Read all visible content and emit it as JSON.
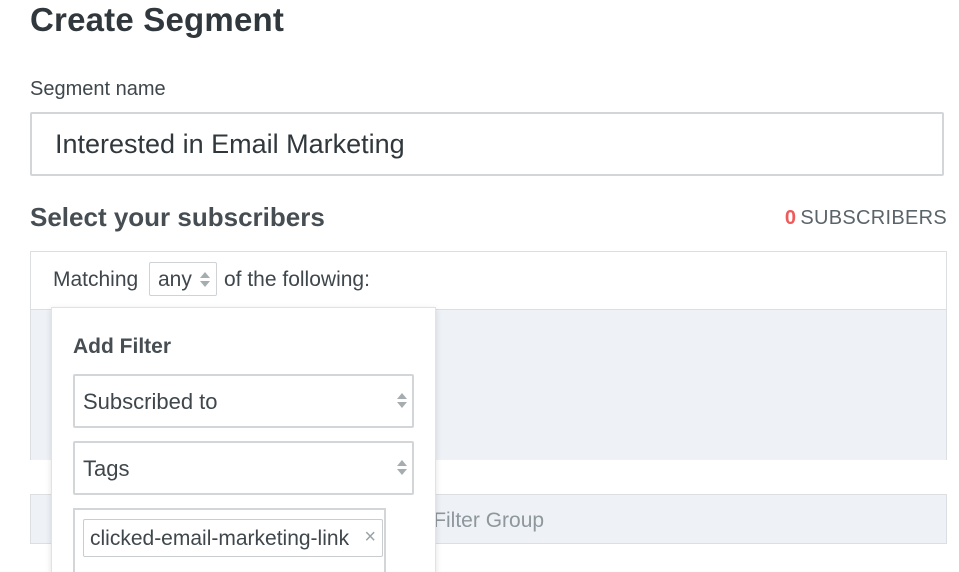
{
  "page": {
    "title": "Create Segment"
  },
  "segment_name": {
    "label": "Segment name",
    "value": "Interested in Email Marketing"
  },
  "subscribers": {
    "heading": "Select your subscribers",
    "count": "0",
    "count_label": "SUBSCRIBERS",
    "count_color": "#ef5b5b"
  },
  "matching": {
    "prefix": "Matching",
    "selected": "any",
    "suffix": "of the following:"
  },
  "add_filter": {
    "title": "Add Filter",
    "first_select": "Subscribed to",
    "second_select": "Tags",
    "tag_chip": "clicked-email-marketing-link",
    "chip_remove": "×",
    "chip_icon": "close-icon"
  },
  "add_filter_group": {
    "label": "dd Filter Group"
  }
}
